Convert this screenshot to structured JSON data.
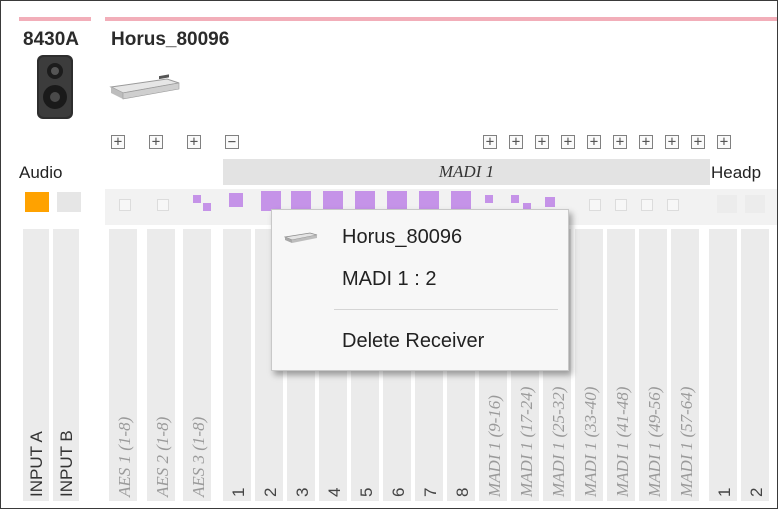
{
  "devices": {
    "speaker_name": "8430A",
    "horus_name": "Horus_80096"
  },
  "expand_buttons": {
    "group1": [
      "+",
      "+",
      "+",
      "−"
    ],
    "group2": [
      "+",
      "+",
      "+",
      "+",
      "+",
      "+",
      "+",
      "+",
      "+",
      "+"
    ]
  },
  "headers": {
    "audio": "Audio",
    "madi": "MADI 1",
    "headphones": "Headp"
  },
  "inputs": [
    "INPUT A",
    "INPUT B"
  ],
  "channels": {
    "aes": [
      "AES 1 (1-8)",
      "AES 2 (1-8)",
      "AES 3 (1-8)"
    ],
    "numbers": [
      "1",
      "2",
      "3",
      "4",
      "5",
      "6",
      "7",
      "8"
    ],
    "madi_groups": [
      "MADI 1 (9-16)",
      "MADI 1 (17-24)",
      "MADI 1 (25-32)",
      "MADI 1 (33-40)",
      "MADI 1 (41-48)",
      "MADI 1 (49-56)",
      "MADI 1 (57-64)"
    ],
    "headphone_numbers": [
      "1",
      "2"
    ]
  },
  "colors": {
    "accent_orange": "#ffa200",
    "routing_purple": "#c593e8",
    "header_pink": "#f2aeb9"
  },
  "context_menu": {
    "device": "Horus_80096",
    "channel": "MADI 1 : 2",
    "delete": "Delete Receiver",
    "icon": "device-icon"
  }
}
